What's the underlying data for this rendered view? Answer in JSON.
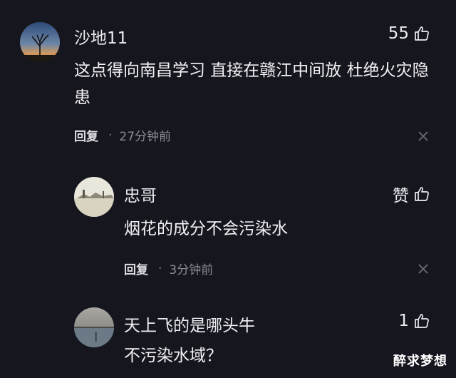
{
  "comments": [
    {
      "user": "沙地11",
      "likes": "55",
      "text": "这点得向南昌学习 直接在赣江中间放 杜绝火灾隐患",
      "reply_label": "回复",
      "dot": "·",
      "time": "27分钟前",
      "avatar_icon": "sunset-tree-avatar",
      "thumb_icon": "thumbs-up-icon",
      "close_icon": "close-icon"
    },
    {
      "user": "忠哥",
      "likes": "赞",
      "text": "烟花的成分不会污染水",
      "reply_label": "回复",
      "dot": "·",
      "time": "3分钟前",
      "avatar_icon": "landscape-avatar",
      "thumb_icon": "thumbs-up-icon",
      "close_icon": "close-icon"
    },
    {
      "user": "天上飞的是哪头牛",
      "likes": "1",
      "text": "不污染水域？",
      "avatar_icon": "lake-avatar",
      "thumb_icon": "thumbs-up-icon"
    }
  ],
  "watermark": "醉求梦想",
  "colors": {
    "background": "#16161e",
    "text": "#ececf1",
    "muted": "#8b8b96"
  }
}
